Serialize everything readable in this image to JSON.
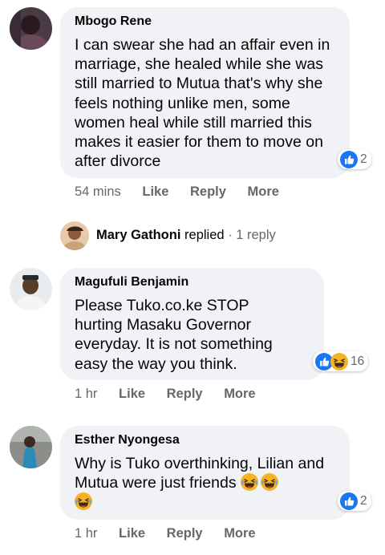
{
  "comments": [
    {
      "author": "Mbogo Rene",
      "text": "I can swear she had an affair even in marriage, she healed while she was still married to Mutua that's why she feels nothing unlike men, some women heal while still married this makes it easier for them to move on after divorce",
      "reaction_count": "2",
      "reaction_icons": [
        "like-icon"
      ],
      "time": "54 mins",
      "actions": [
        "Like",
        "Reply",
        "More"
      ]
    },
    {
      "author": "Magufuli Benjamin",
      "text": "Please Tuko.co.ke STOP hurting Masaku Governor everyday. It is not something easy the way you think.",
      "reaction_count": "16",
      "reaction_icons": [
        "like-icon",
        "laugh-icon"
      ],
      "time": "1 hr",
      "actions": [
        "Like",
        "Reply",
        "More"
      ]
    },
    {
      "author": "Esther Nyongesa",
      "text": "Why is Tuko overthinking, Lilian and Mutua were just friends",
      "text_emojis": [
        "laugh-icon",
        "laugh-icon",
        "laugh-icon"
      ],
      "reaction_count": "2",
      "reaction_icons": [
        "like-icon"
      ],
      "time": "1 hr",
      "actions": [
        "Like",
        "Reply",
        "More"
      ]
    }
  ],
  "reply_summary": {
    "author": "Mary Gathoni",
    "verb": "replied",
    "separator": " · ",
    "count": "1 reply"
  },
  "colors": {
    "bubble": "#f0f2f5",
    "like_blue": "#1877f2",
    "meta_gray": "#65676b",
    "laugh_yellow": "#f7b125"
  }
}
